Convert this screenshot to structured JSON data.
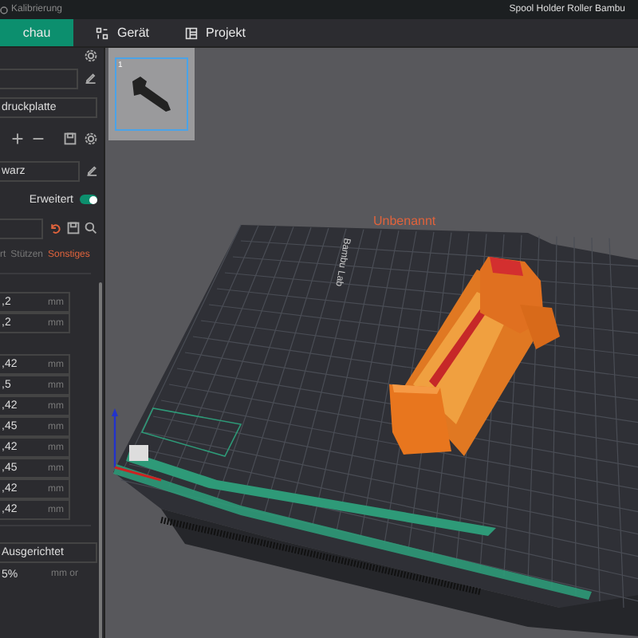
{
  "title_bar": {
    "menu_item": "Kalibrierung",
    "project_title": "Spool Holder Roller Bambu"
  },
  "tabs": [
    {
      "label": "chau",
      "selected": true
    },
    {
      "label": "Gerät",
      "selected": false
    },
    {
      "label": "Projekt",
      "selected": false
    }
  ],
  "plate_thumbnails": [
    {
      "number": "1",
      "selected": true
    }
  ],
  "sidebar": {
    "plate_field": "druckplatte",
    "filament_field": "warz",
    "advanced": {
      "label": "Erweitert",
      "on": true
    },
    "setting_tabs": [
      {
        "label": "rt",
        "selected": false
      },
      {
        "label": "Stützen",
        "selected": false
      },
      {
        "label": "Sonstiges",
        "selected": true
      }
    ],
    "group_1": [
      {
        "value": ",2",
        "unit": "mm"
      },
      {
        "value": ",2",
        "unit": "mm"
      }
    ],
    "group_2": [
      {
        "value": ",42",
        "unit": "mm"
      },
      {
        "value": ",5",
        "unit": "mm"
      },
      {
        "value": ",42",
        "unit": "mm"
      },
      {
        "value": ",45",
        "unit": "mm"
      },
      {
        "value": ",42",
        "unit": "mm"
      },
      {
        "value": ",45",
        "unit": "mm"
      },
      {
        "value": ",42",
        "unit": "mm"
      },
      {
        "value": ",42",
        "unit": "mm"
      }
    ],
    "seam": {
      "value": "Ausgerichtet"
    },
    "wipe": {
      "value": "5%",
      "unit": "mm or"
    }
  },
  "viewport": {
    "plate_name": "Unbenannt",
    "bed_logo": "Bambu Lab"
  }
}
